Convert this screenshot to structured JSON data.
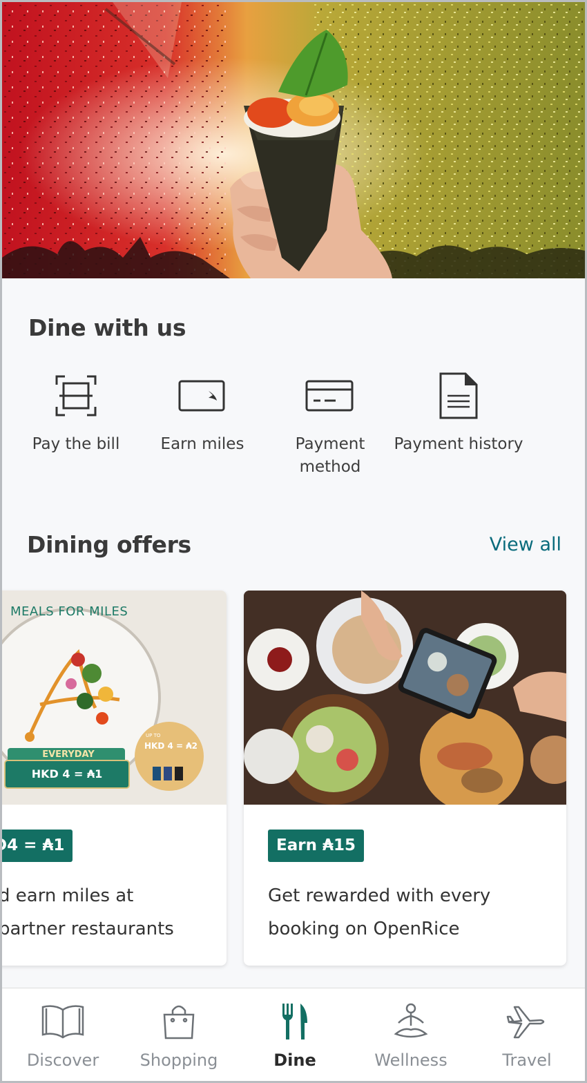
{
  "hero": {
    "image": "hand-roll-sushi-concert-confetti"
  },
  "dine_section": {
    "title": "Dine with us",
    "actions": [
      {
        "icon": "scan-icon",
        "label": "Pay the bill"
      },
      {
        "icon": "card-plane-icon",
        "label": "Earn miles"
      },
      {
        "icon": "credit-card-icon",
        "label": "Payment method"
      },
      {
        "icon": "document-icon",
        "label": "Payment history"
      }
    ]
  },
  "offers_section": {
    "title": "Dining offers",
    "view_all": "View all",
    "cards": [
      {
        "image_texts": {
          "headline": "MEALS FOR MILES",
          "ribbon": "EVERYDAY",
          "rate": "HKD 4 = ₳1",
          "upto_small": "UP TO",
          "upto_rate": "HKD 4 = ₳2"
        },
        "badge": "D4 = ₳1",
        "line1": "d earn miles at",
        "line2": "partner restaurants"
      },
      {
        "image_texts": {},
        "badge": "Earn ₳15",
        "line1": "Get rewarded with every",
        "line2": "booking on OpenRice"
      }
    ]
  },
  "tabbar": {
    "tabs": [
      {
        "icon": "book-icon",
        "label": "Discover",
        "active": false
      },
      {
        "icon": "shopping-bag-icon",
        "label": "Shopping",
        "active": false
      },
      {
        "icon": "fork-knife-icon",
        "label": "Dine",
        "active": true
      },
      {
        "icon": "meditation-icon",
        "label": "Wellness",
        "active": false
      },
      {
        "icon": "airplane-icon",
        "label": "Travel",
        "active": false
      }
    ],
    "active_color": "#136f63",
    "inactive_color": "#6b7075"
  },
  "colors": {
    "accent": "#0a6b7c",
    "badge": "#136f63",
    "background": "#f7f8fa"
  }
}
